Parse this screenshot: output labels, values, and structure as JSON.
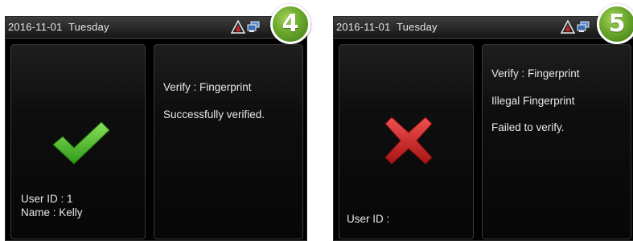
{
  "screens": [
    {
      "status_bar": {
        "date": "2016-11-01",
        "day": "Tuesday"
      },
      "step_number": "4",
      "result": "success",
      "left_panel": {
        "user_id": "User ID : 1",
        "name": "Name : Kelly"
      },
      "right_panel": {
        "line1": "Verify : Fingerprint",
        "line2": "Successfully verified."
      }
    },
    {
      "status_bar": {
        "date": "2016-11-01",
        "day": "Tuesday"
      },
      "step_number": "5",
      "result": "failure",
      "left_panel": {
        "user_id": "User ID :"
      },
      "right_panel": {
        "line1": "Verify : Fingerprint",
        "line2": "Illegal Fingerprint",
        "line3": "Failed to verify."
      }
    }
  ],
  "icons": {
    "alarm": "alarm-warning-icon",
    "network": "network-computers-icon",
    "success": "check-mark-icon",
    "failure": "cross-mark-icon"
  },
  "colors": {
    "success_green": "#5cc02a",
    "failure_red": "#d32020",
    "badge_green": "#6aa82c",
    "screen_bg": "#000000",
    "text": "#e8e8e8"
  }
}
